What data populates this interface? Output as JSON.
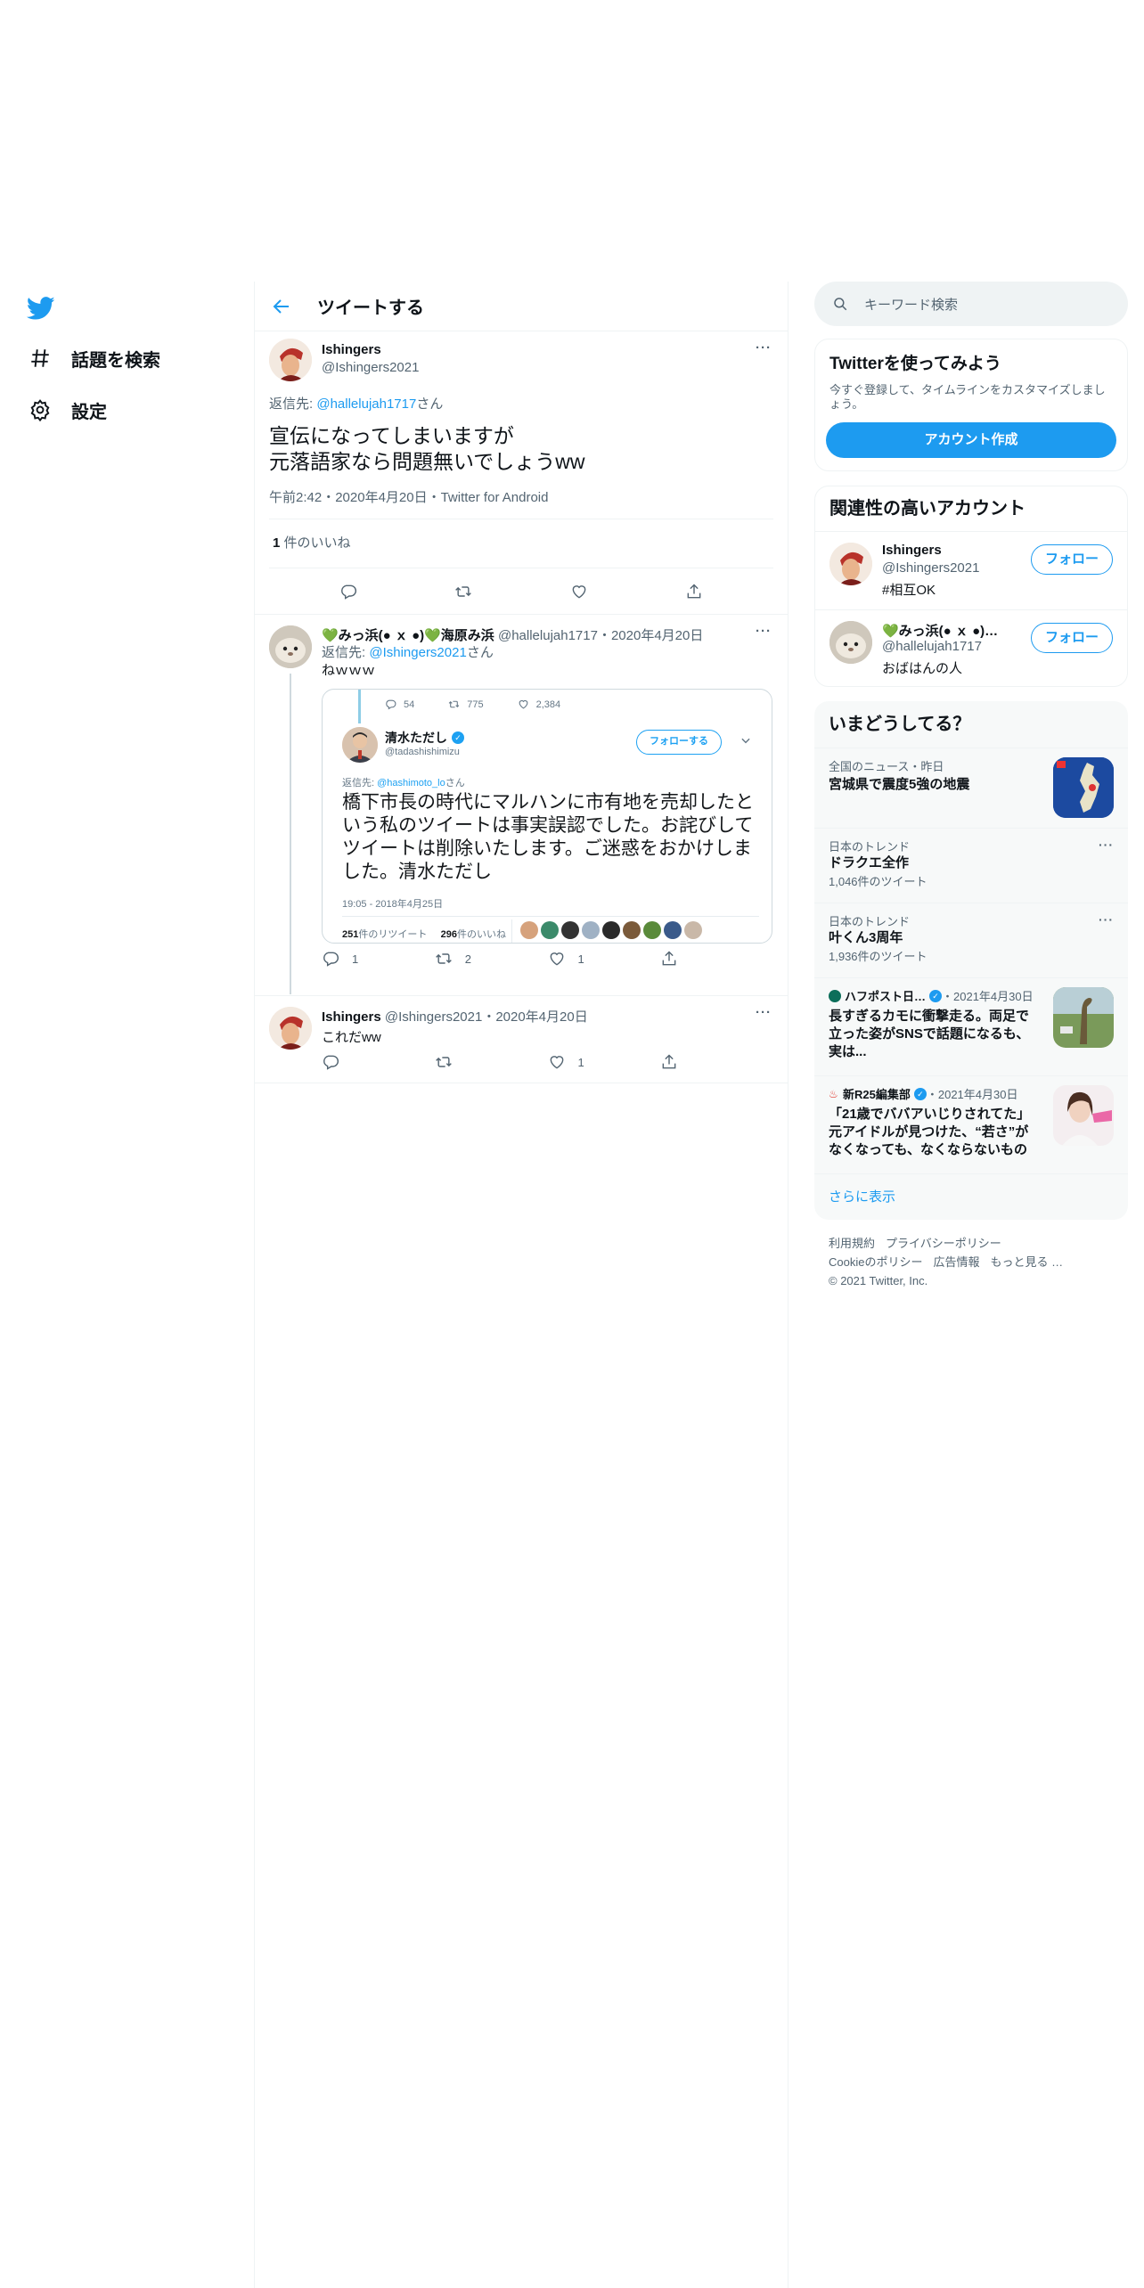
{
  "nav": {
    "items": [
      {
        "label": "話題を検索",
        "icon": "hashtag-icon"
      },
      {
        "label": "設定",
        "icon": "gear-icon"
      }
    ]
  },
  "header": {
    "title": "ツイートする"
  },
  "focus_tweet": {
    "name": "Ishingers",
    "handle": "@Ishingers2021",
    "reply_prefix": "返信先: ",
    "reply_handle": "@hallelujah1717",
    "reply_suffix": "さん",
    "text_line1": "宣伝になってしまいますが",
    "text_line2": "元落語家なら問題無いでしょうww",
    "meta": "午前2:42・2020年4月20日・Twitter for Android",
    "likes_count": "1",
    "likes_label": " 件のいいね"
  },
  "reply1": {
    "name": "💚みっ浜(● ｘ ●)💚海原み浜",
    "handle_time": " @hallelujah1717・2020年4月20日",
    "reply_prefix": "返信先: ",
    "reply_handle": "@Ishingers2021",
    "reply_suffix": "さん",
    "text": "ねｗｗｗ",
    "reply_count": "1",
    "retweet_count": "2",
    "like_count": "1",
    "embed": {
      "top_reply": "54",
      "top_retweet": "775",
      "top_like": "2,384",
      "name": "清水ただし",
      "handle": "@tadashishimizu",
      "follow": "フォローする",
      "reply_prefix": "返信先: ",
      "reply_handle": "@hashimoto_lo",
      "reply_suffix": "さん",
      "text": "橋下市長の時代にマルハンに市有地を売却したという私のツイートは事実誤認でした。お詫びしてツイートは削除いたします。ご迷惑をおかけしました。清水ただし",
      "time": "19:05 - 2018年4月25日",
      "rt_num": "251",
      "rt_label": "件のリツイート",
      "like_num": "296",
      "like_label": "件のいいね"
    }
  },
  "reply2": {
    "name": "Ishingers",
    "handle_time": " @Ishingers2021・2020年4月20日",
    "text": "これだww",
    "like_count": "1"
  },
  "search": {
    "placeholder": "キーワード検索"
  },
  "signup": {
    "title": "Twitterを使ってみよう",
    "desc": "今すぐ登録して、タイムラインをカスタマイズしましょう。",
    "button": "アカウント作成"
  },
  "related": {
    "title": "関連性の高いアカウント",
    "accounts": [
      {
        "name": "Ishingers",
        "handle": "@Ishingers2021",
        "bio": "#相互OK",
        "follow": "フォロー"
      },
      {
        "name": "💚みっ浜(● ｘ ●)💚…",
        "handle": "@hallelujah1717",
        "bio": "おばはんの人",
        "follow": "フォロー"
      }
    ]
  },
  "trends": {
    "title": "いまどうしてる？",
    "items": [
      {
        "meta": "全国のニュース・昨日",
        "title": "宮城県で震度5強の地震"
      },
      {
        "meta": "日本のトレンド",
        "title": "ドラクエ全作",
        "count": "1,046件のツイート"
      },
      {
        "meta": "日本のトレンド",
        "title": "叶くん3周年",
        "count": "1,936件のツイート"
      },
      {
        "source": "ハフポスト日…",
        "date": "・2021年4月30日",
        "title": "長すぎるカモに衝撃走る。両足で立った姿がSNSで話題になるも、実は..."
      },
      {
        "source": "新R25編集部",
        "date": "・2021年4月30日",
        "title": "「21歳でババアいじりされてた」元アイドルが見つけた、“若さ”がなくなっても、なくならないもの"
      }
    ],
    "show_more": "さらに表示"
  },
  "footer": {
    "line1a": "利用規約",
    "line1b": "プライバシーポリシー",
    "line2a": "Cookieのポリシー",
    "line2b": "広告情報",
    "line2c": "もっと見る …",
    "copyright": "© 2021 Twitter, Inc."
  },
  "colors": {
    "accent": "#1d9bf0",
    "text": "#0f1419",
    "muted": "#536471",
    "border": "#eff3f4"
  }
}
